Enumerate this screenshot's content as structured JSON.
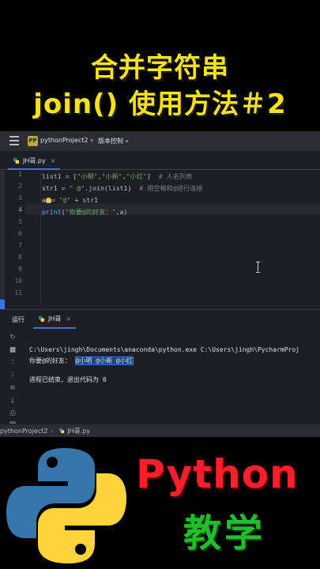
{
  "title": {
    "line1": "合并字符串",
    "line2": "join() 使用方法＃2"
  },
  "ide": {
    "project_badge": "PP",
    "project_name": "pythonProject2",
    "vcs_label": "版本控制",
    "editor_tab": "JH哥.py",
    "line_numbers": [
      "1",
      "2",
      "3",
      "4",
      "5",
      "6",
      "7",
      "8",
      "9",
      "10",
      "11"
    ],
    "current_line": 4,
    "code": {
      "line1": {
        "a": "list1 = [",
        "s1": "\"小明\"",
        "c1": ",",
        "s2": "\"小新\"",
        "c2": ",",
        "s3": "\"小红\"",
        "b": "]",
        "cmt": "  # 人名列表"
      },
      "line2": {
        "a": "str1 = ",
        "s": "\" @\"",
        "b": ".join(list1)",
        "cmt": "  # 用空格和@进行连接"
      },
      "line3": {
        "a": "a",
        "b": "= ",
        "s": "\"@\"",
        "c": " + str1"
      },
      "line4": {
        "fn": "print",
        "b": "(",
        "s": "\"你要@的好友：\"",
        "c": ",a)"
      }
    },
    "run": {
      "label": "运行",
      "tab": "JH哥",
      "console_line1": "C:\\Users\\jingh\\Documents\\anaconda\\python.exe C:\\Users\\jingh\\PycharmProj",
      "console_line2_prefix": "你要@的好友： ",
      "console_line2_selected": "@小明 @小新 @小红",
      "console_line3": "进程已结束，退出代码为 0"
    },
    "breadcrumb": {
      "project": "pythonProject2",
      "file": "JH哥.py"
    }
  },
  "brand": {
    "python": "Python",
    "teaching": "教学"
  },
  "colors": {
    "title_yellow": "#f6e21a",
    "python_red": "#ff1f2b",
    "teaching_green": "#1fbf2a",
    "logo_blue": "#3776ab",
    "logo_yellow": "#ffd43b",
    "selection": "#214283"
  }
}
